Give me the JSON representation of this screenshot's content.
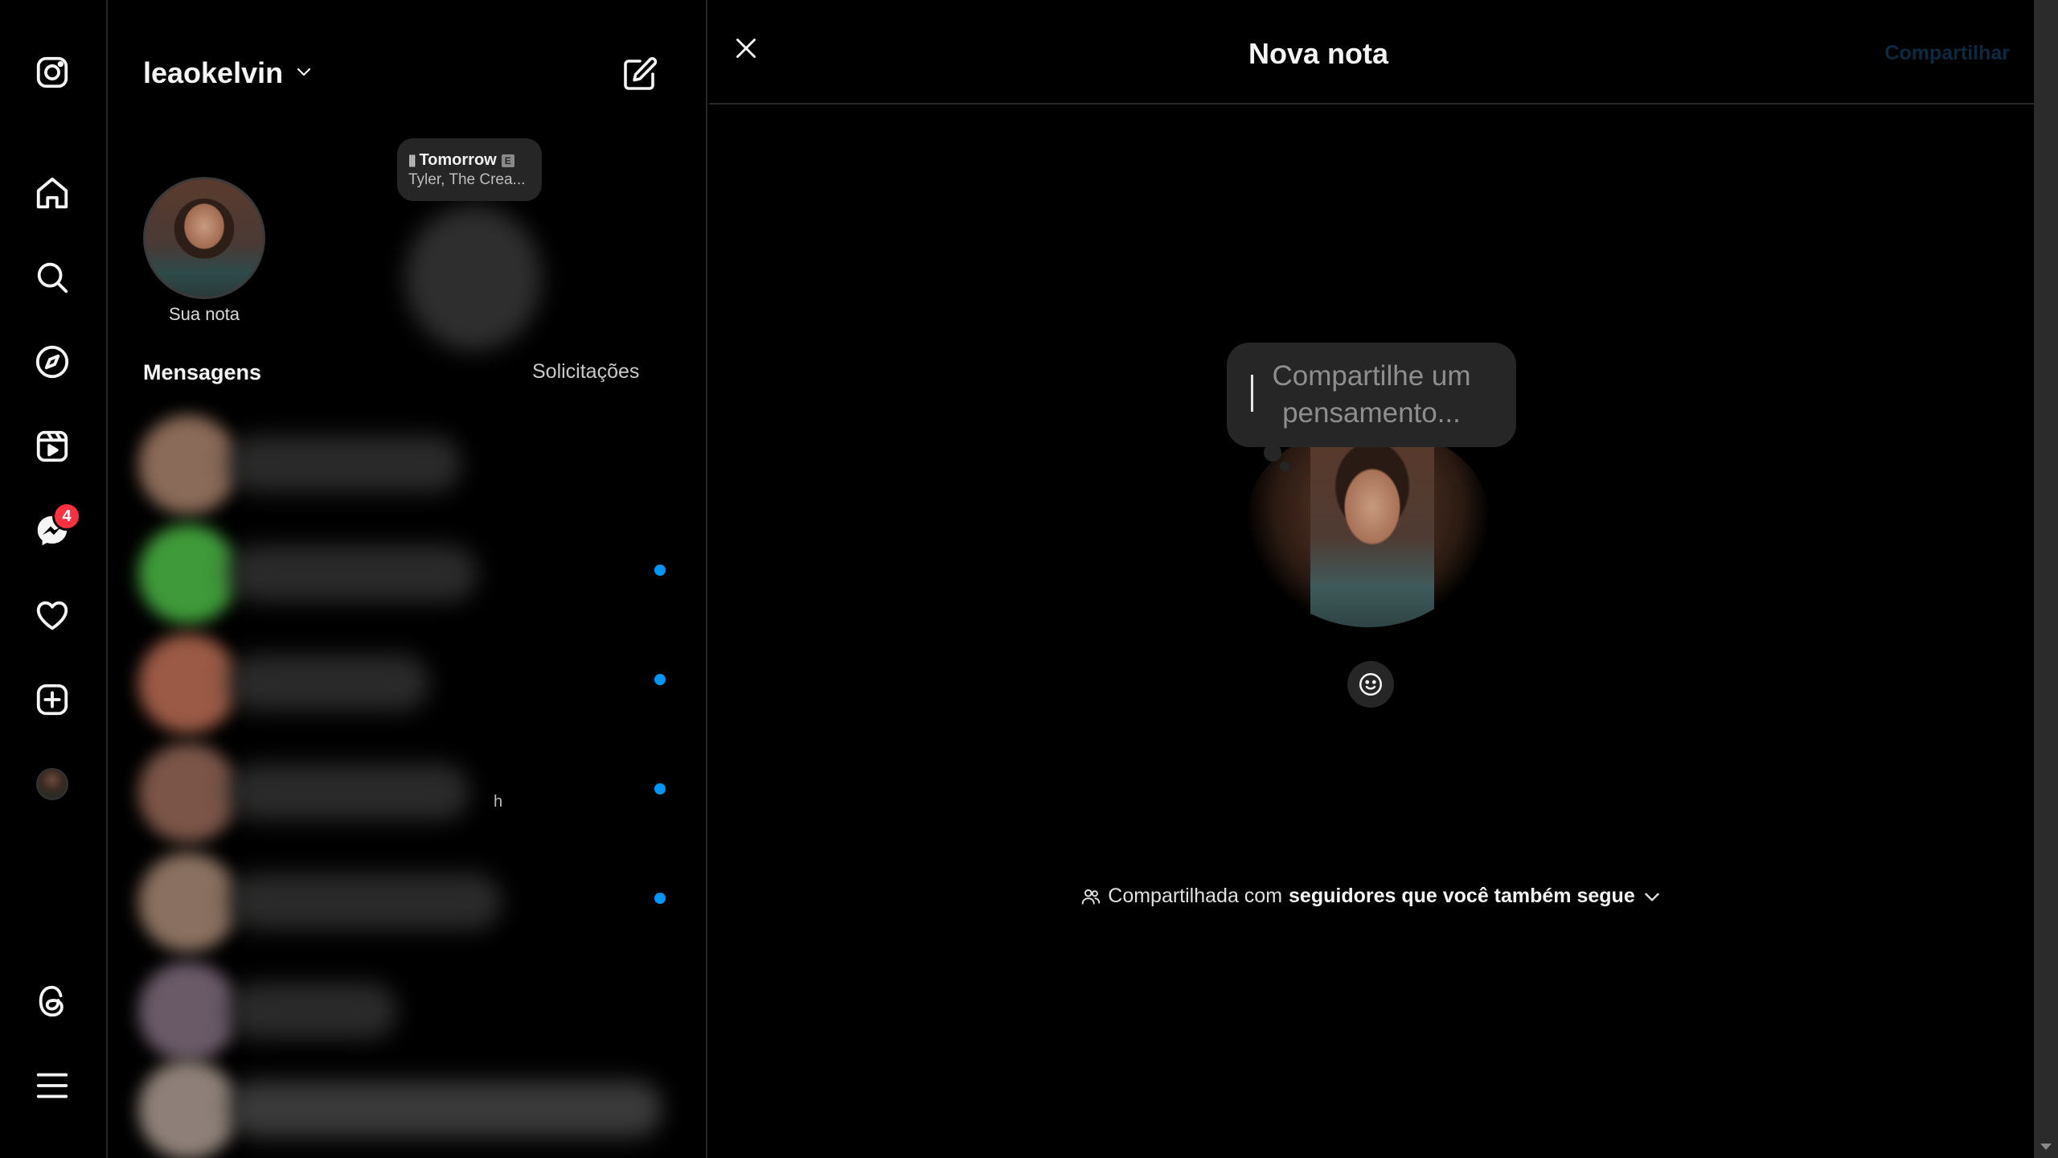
{
  "rail": {
    "messages_badge": "4",
    "icons": [
      "instagram-icon",
      "home-icon",
      "search-icon",
      "explore-icon",
      "reels-icon",
      "messenger-icon",
      "heart-icon",
      "create-icon",
      "profile-avatar",
      "threads-icon",
      "menu-icon"
    ]
  },
  "panel": {
    "username": "leaokelvin",
    "my_note_label": "Sua nota",
    "music_note": {
      "title": "Tomorrow",
      "explicit": "E",
      "artist": "Tyler, The Crea..."
    },
    "messages_title": "Mensagens",
    "requests_label": "Solicitações",
    "thread_time": "h"
  },
  "editor": {
    "title": "Nova nota",
    "share_label": "Compartilhar",
    "placeholder": "Compartilhe um pensamento...",
    "audience_prefix": "Compartilhada com",
    "audience_value": "seguidores que você também segue"
  },
  "colors": {
    "accent": "#0095f6",
    "badge": "#ff3040",
    "bubble": "#262626"
  }
}
